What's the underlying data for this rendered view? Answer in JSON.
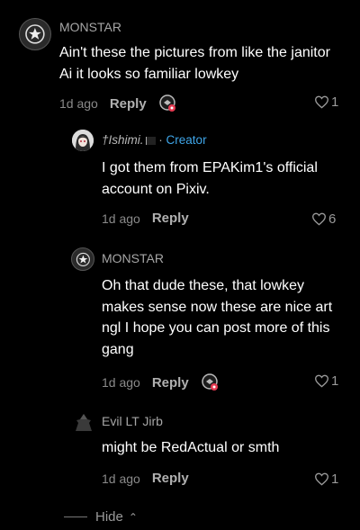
{
  "comments": [
    {
      "username": "MONSTAR",
      "text": "Ain't these the pictures from like the janitor Ai it looks so familiar lowkey",
      "time": "1d ago",
      "reply_label": "Reply",
      "likes": "1",
      "avatar_icon": "star-badge-icon"
    },
    {
      "username": "†Ishimi.",
      "creator_separator": "·",
      "creator_label": "Creator",
      "text": "I got them from EPAKim1's official account on Pixiv.",
      "time": "1d ago",
      "reply_label": "Reply",
      "likes": "6",
      "avatar_icon": "anime-girl-avatar"
    },
    {
      "username": "MONSTAR",
      "text": "Oh that dude these, that lowkey makes sense now these are nice art ngl I hope you can post more of this gang",
      "time": "1d ago",
      "reply_label": "Reply",
      "likes": "1",
      "avatar_icon": "star-badge-icon"
    },
    {
      "username": "Evil LT Jirb",
      "text": "might be RedActual or smth",
      "time": "1d ago",
      "reply_label": "Reply",
      "likes": "1",
      "avatar_icon": "dark-figure-avatar"
    }
  ],
  "hide_label": "Hide",
  "colors": {
    "creator": "#3fa6e9",
    "background": "#000000"
  }
}
